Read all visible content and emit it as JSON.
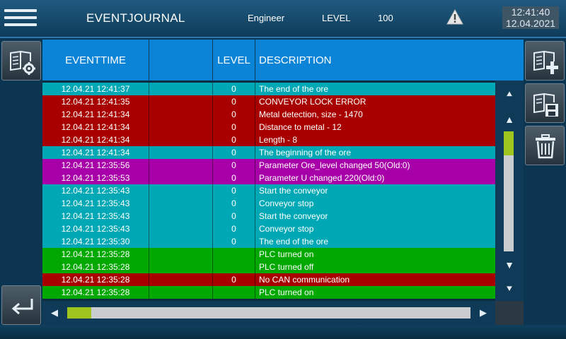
{
  "header": {
    "title": "EVENTJOURNAL",
    "user": "Engineer",
    "level_label": "LEVEL",
    "level_value": "100",
    "time": "12:41:40",
    "date": "12.04.2021"
  },
  "table": {
    "columns": [
      "EVENTTIME",
      "",
      "LEVEL",
      "DESCRIPTION"
    ],
    "rows": [
      {
        "time": "12.04.21 12:41:37",
        "col2": "",
        "level": "0",
        "description": "The end of the ore",
        "color": "#00a8b5"
      },
      {
        "time": "12.04.21 12:41:35",
        "col2": "",
        "level": "0",
        "description": "CONVEYOR LOCK ERROR",
        "color": "#a80000"
      },
      {
        "time": "12.04.21 12:41:34",
        "col2": "",
        "level": "0",
        "description": "Metal detection, size - 1470",
        "color": "#a80000"
      },
      {
        "time": "12.04.21 12:41:34",
        "col2": "",
        "level": "0",
        "description": "Distance to metal - 12",
        "color": "#a80000"
      },
      {
        "time": "12.04.21 12:41:34",
        "col2": "",
        "level": "0",
        "description": "Length - 8",
        "color": "#a80000"
      },
      {
        "time": "12.04.21 12:41:34",
        "col2": "",
        "level": "0",
        "description": "The beginning of the ore",
        "color": "#00a8b5"
      },
      {
        "time": "12.04.21 12:35:56",
        "col2": "",
        "level": "0",
        "description": "Parameter Ore_level changed 50(Old:0)",
        "color": "#a800a8"
      },
      {
        "time": "12.04.21 12:35:53",
        "col2": "",
        "level": "0",
        "description": "Parameter U changed 220(Old:0)",
        "color": "#a800a8"
      },
      {
        "time": "12.04.21 12:35:43",
        "col2": "",
        "level": "0",
        "description": "Start the conveyor",
        "color": "#00a8b5"
      },
      {
        "time": "12.04.21 12:35:43",
        "col2": "",
        "level": "0",
        "description": "Conveyor stop",
        "color": "#00a8b5"
      },
      {
        "time": "12.04.21 12:35:43",
        "col2": "",
        "level": "0",
        "description": "Start the conveyor",
        "color": "#00a8b5"
      },
      {
        "time": "12.04.21 12:35:43",
        "col2": "",
        "level": "0",
        "description": "Conveyor stop",
        "color": "#00a8b5"
      },
      {
        "time": "12.04.21 12:35:30",
        "col2": "",
        "level": "0",
        "description": "The end of the ore",
        "color": "#00a8b5"
      },
      {
        "time": "12.04.21 12:35:28",
        "col2": "",
        "level": "",
        "description": "PLC turned on",
        "color": "#00a800"
      },
      {
        "time": "12.04.21 12:35:28",
        "col2": "",
        "level": "",
        "description": "PLC turned off",
        "color": "#00a800"
      },
      {
        "time": "12.04.21 12:35:28",
        "col2": "",
        "level": "0",
        "description": "No CAN communication",
        "color": "#a80000"
      },
      {
        "time": "12.04.21 12:35:28",
        "col2": "",
        "level": "",
        "description": "PLC turned on",
        "color": "#00a800"
      }
    ]
  },
  "icons": {
    "menu": "hamburger-menu-icon",
    "warning": "warning-triangle-icon",
    "journal_settings": "journal-settings-icon",
    "back": "back-arrow-icon",
    "add_entry": "journal-add-icon",
    "save": "journal-save-icon",
    "delete": "trash-icon"
  },
  "scroll": {
    "vertical_position": 0,
    "horizontal_position": 0
  },
  "colors": {
    "header_bg": "#0b84d8",
    "info_row": "#00a8b5",
    "error_row": "#a80000",
    "param_row": "#a800a8",
    "plc_row": "#00a800",
    "scroll_thumb": "#9ec61e"
  }
}
